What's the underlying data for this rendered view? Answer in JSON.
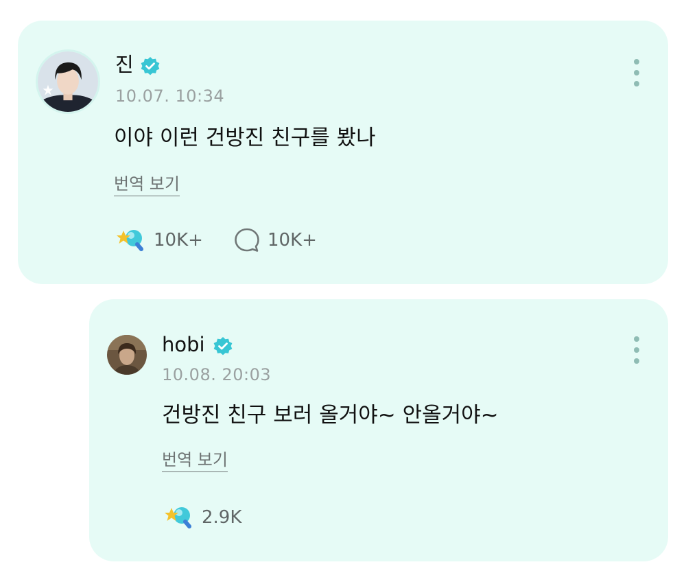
{
  "post": {
    "author": "진",
    "verified": true,
    "timestamp": "10.07. 10:34",
    "content": "이야 이런 건방진 친구를 봤나",
    "translate_label": "번역 보기",
    "likes": "10K+",
    "comments": "10K+",
    "accent_color": "#38c6d4"
  },
  "reply": {
    "author": "hobi",
    "verified": true,
    "timestamp": "10.08. 20:03",
    "content": "건방진 친구 보러 올거야~ 안올거야~",
    "translate_label": "번역 보기",
    "likes": "2.9K"
  }
}
